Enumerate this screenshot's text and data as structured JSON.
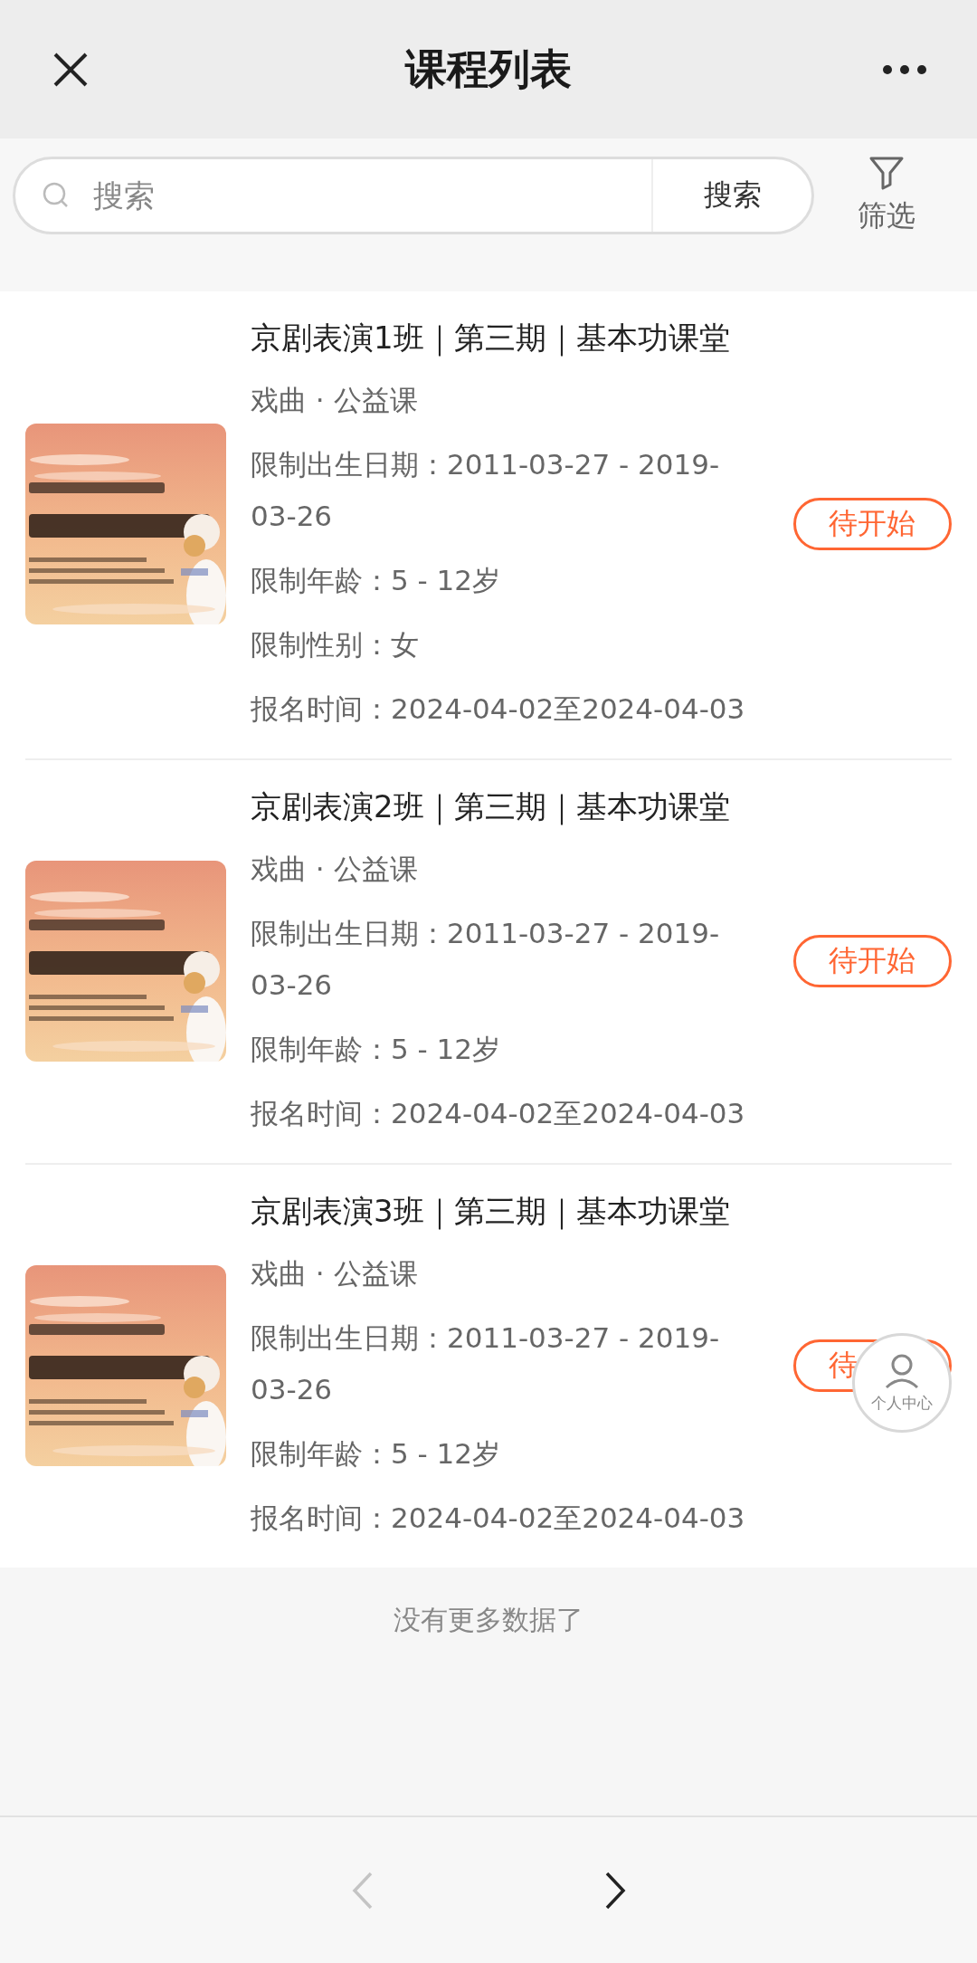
{
  "navbar": {
    "title": "课程列表"
  },
  "search": {
    "placeholder": "搜索",
    "button": "搜索",
    "filter_label": "筛选"
  },
  "courses": [
    {
      "title": "京剧表演1班｜第三期｜基本功课堂",
      "category": "戏曲 · 公益课",
      "details": [
        "限制出生日期：2011-03-27 - 2019-03-26",
        "限制年龄：5 - 12岁",
        "限制性别：女",
        "报名时间：2024-04-02至2024-04-03"
      ],
      "status": "待开始"
    },
    {
      "title": "京剧表演2班｜第三期｜基本功课堂",
      "category": "戏曲 · 公益课",
      "details": [
        "限制出生日期：2011-03-27 - 2019-03-26",
        "限制年龄：5 - 12岁",
        "报名时间：2024-04-02至2024-04-03"
      ],
      "status": "待开始"
    },
    {
      "title": "京剧表演3班｜第三期｜基本功课堂",
      "category": "戏曲 · 公益课",
      "details": [
        "限制出生日期：2011-03-27 - 2019-03-26",
        "限制年龄：5 - 12岁",
        "报名时间：2024-04-02至2024-04-03"
      ],
      "status": "待"
    }
  ],
  "end_text": "没有更多数据了",
  "floating_button": {
    "label": "个人中心"
  },
  "bottom_nav": {
    "back": {
      "disabled": true
    },
    "forward": {
      "disabled": false
    }
  }
}
